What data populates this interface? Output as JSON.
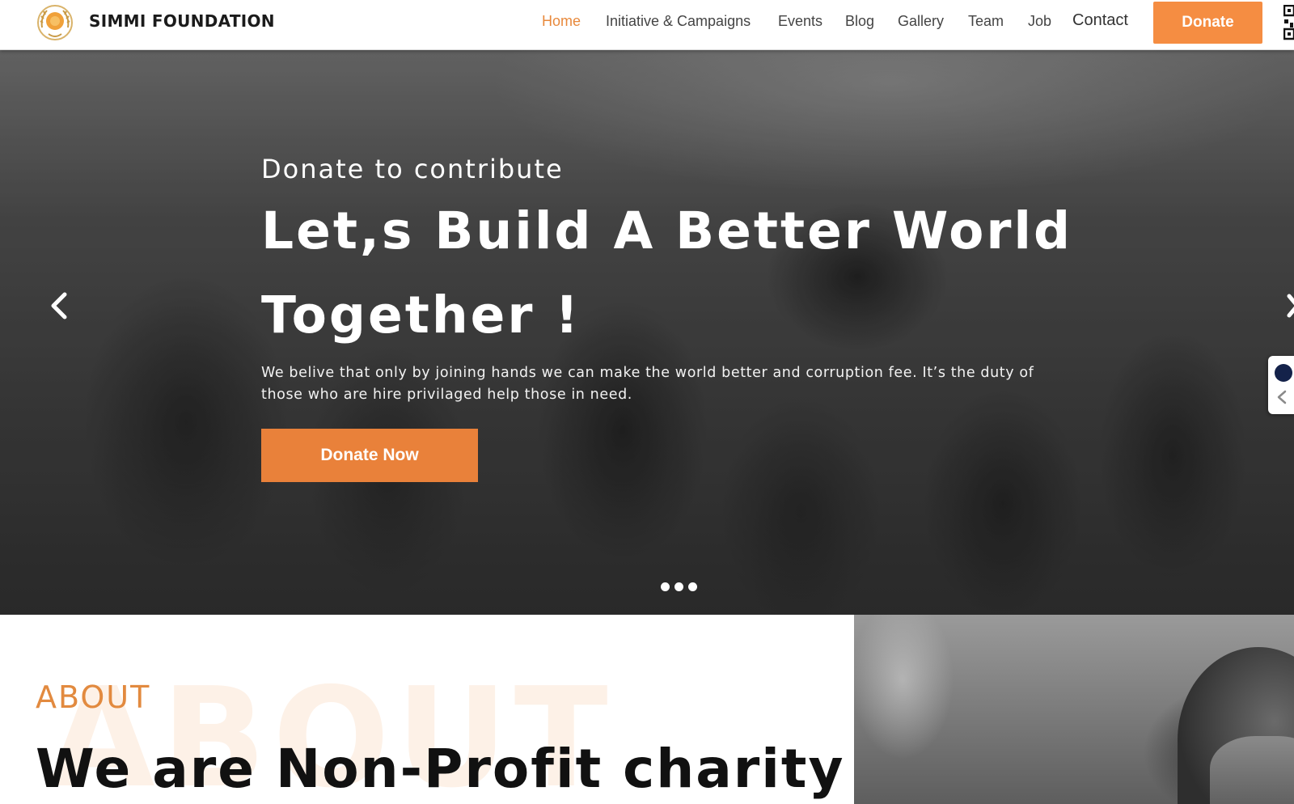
{
  "header": {
    "brand": "SIMMI FOUNDATION",
    "nav": [
      {
        "label": "Home",
        "active": true
      },
      {
        "label": "Initiative & Campaigns",
        "active": false
      },
      {
        "label": "Events",
        "active": false
      },
      {
        "label": "Blog",
        "active": false
      },
      {
        "label": "Gallery",
        "active": false
      },
      {
        "label": "Team",
        "active": false
      },
      {
        "label": "Job",
        "active": false
      },
      {
        "label": "Contact",
        "active": false
      }
    ],
    "donate_label": "Donate"
  },
  "hero": {
    "subtitle": "Donate to contribute",
    "title": "Let,s Build A Better World Together !",
    "text": "We belive that only by joining hands we can make the world better and corruption fee. It’s the duty of those who are hire privilaged help those in need.",
    "cta_label": "Donate Now",
    "slide_count": 3
  },
  "about": {
    "watermark": "ABOUT",
    "label": "ABOUT",
    "heading": "We are Non-Profit charity"
  },
  "colors": {
    "accent": "#f58d42",
    "accent_dark": "#e9813a",
    "nav_active": "#e8893c",
    "text_dark": "#111111"
  },
  "icons": {
    "logo": "foundation-emblem-icon",
    "qr": "qr-code-icon",
    "prev": "chevron-left-icon",
    "next": "chevron-right-icon",
    "side_toggle": "chevron-left-icon"
  }
}
